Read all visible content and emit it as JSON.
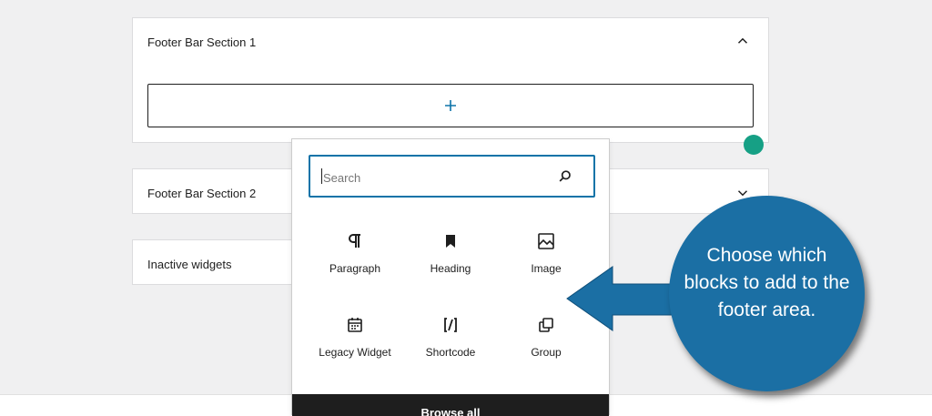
{
  "sections": {
    "section1": {
      "title": "Footer Bar Section 1",
      "expanded": true
    },
    "section2": {
      "title": "Footer Bar Section 2",
      "expanded": false
    },
    "inactive": {
      "title": "Inactive widgets"
    }
  },
  "appender": {
    "icon": "plus-icon"
  },
  "inserter": {
    "search_placeholder": "Search",
    "blocks": [
      {
        "label": "Paragraph",
        "icon": "paragraph-icon"
      },
      {
        "label": "Heading",
        "icon": "bookmark-icon"
      },
      {
        "label": "Image",
        "icon": "image-icon"
      },
      {
        "label": "Legacy Widget",
        "icon": "calendar-icon"
      },
      {
        "label": "Shortcode",
        "icon": "shortcode-icon"
      },
      {
        "label": "Group",
        "icon": "group-icon"
      }
    ],
    "browse_all": "Browse all"
  },
  "callout": {
    "text": "Choose which blocks to add to the footer area."
  },
  "colors": {
    "accent": "#0d73a8",
    "callout": "#1b6fa4",
    "green": "#16a085"
  }
}
